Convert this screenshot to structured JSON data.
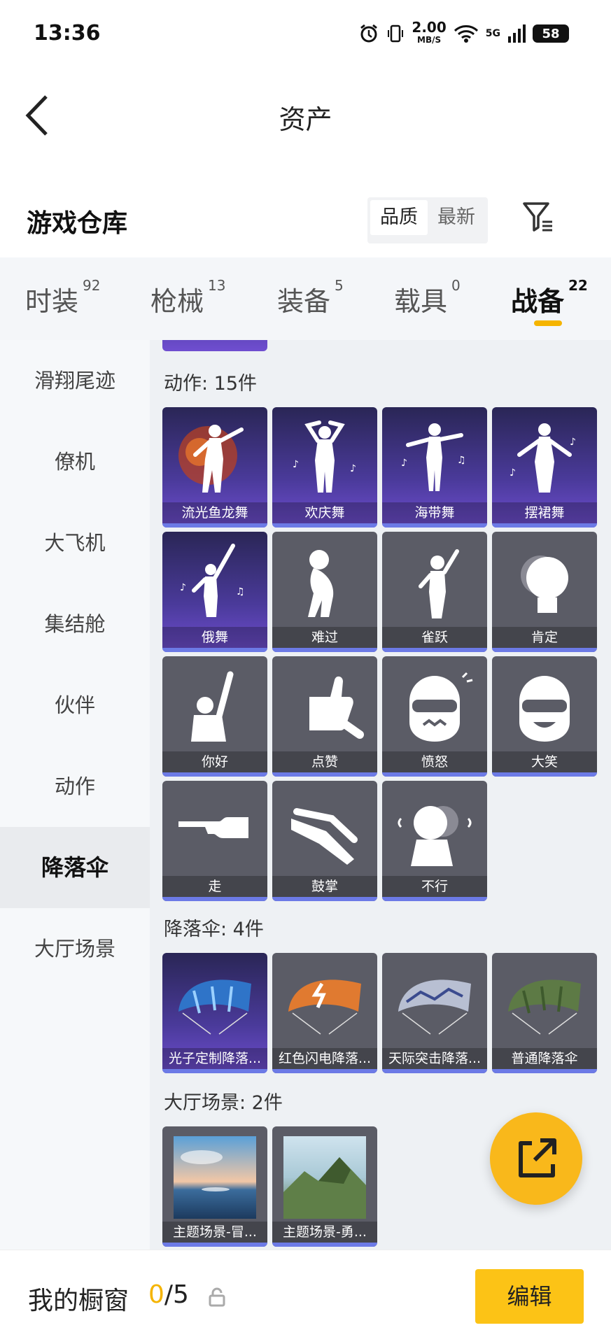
{
  "status_bar": {
    "time": "13:36",
    "net_speed": "2.00",
    "net_unit": "MB/S",
    "signal": "5G",
    "battery": "58"
  },
  "header": {
    "title": "资产"
  },
  "page": {
    "heading": "游戏仓库",
    "sort_options": [
      "品质",
      "最新"
    ],
    "active_sort": "品质"
  },
  "tabs": [
    {
      "label": "时装",
      "count": "92"
    },
    {
      "label": "枪械",
      "count": "13"
    },
    {
      "label": "装备",
      "count": "5"
    },
    {
      "label": "载具",
      "count": "0"
    },
    {
      "label": "战备",
      "count": "22"
    }
  ],
  "active_tab": "战备",
  "sidebar": {
    "items": [
      "滑翔尾迹",
      "僚机",
      "大飞机",
      "集结舱",
      "伙伴",
      "动作",
      "降落伞",
      "大厅场景"
    ],
    "active": "降落伞"
  },
  "sections": {
    "action": {
      "title": "动作: 15件",
      "items": [
        "流光鱼龙舞",
        "欢庆舞",
        "海带舞",
        "摆裙舞",
        "俄舞",
        "难过",
        "雀跃",
        "肯定",
        "你好",
        "点赞",
        "愤怒",
        "大笑",
        "走",
        "鼓掌",
        "不行"
      ]
    },
    "parachute": {
      "title": "降落伞: 4件",
      "items": [
        "光子定制降落...",
        "红色闪电降落...",
        "天际突击降落...",
        "普通降落伞"
      ]
    },
    "lobby": {
      "title": "大厅场景: 2件",
      "items": [
        "主题场景-冒...",
        "主题场景-勇..."
      ]
    }
  },
  "bottom_bar": {
    "label": "我的橱窗",
    "current": "0",
    "total": "/5",
    "edit_label": "编辑"
  },
  "colors": {
    "accent": "#f5b400",
    "edit_button": "#fcc316",
    "fab": "#f9b81b",
    "tile_bar": "#6c7ae6"
  }
}
